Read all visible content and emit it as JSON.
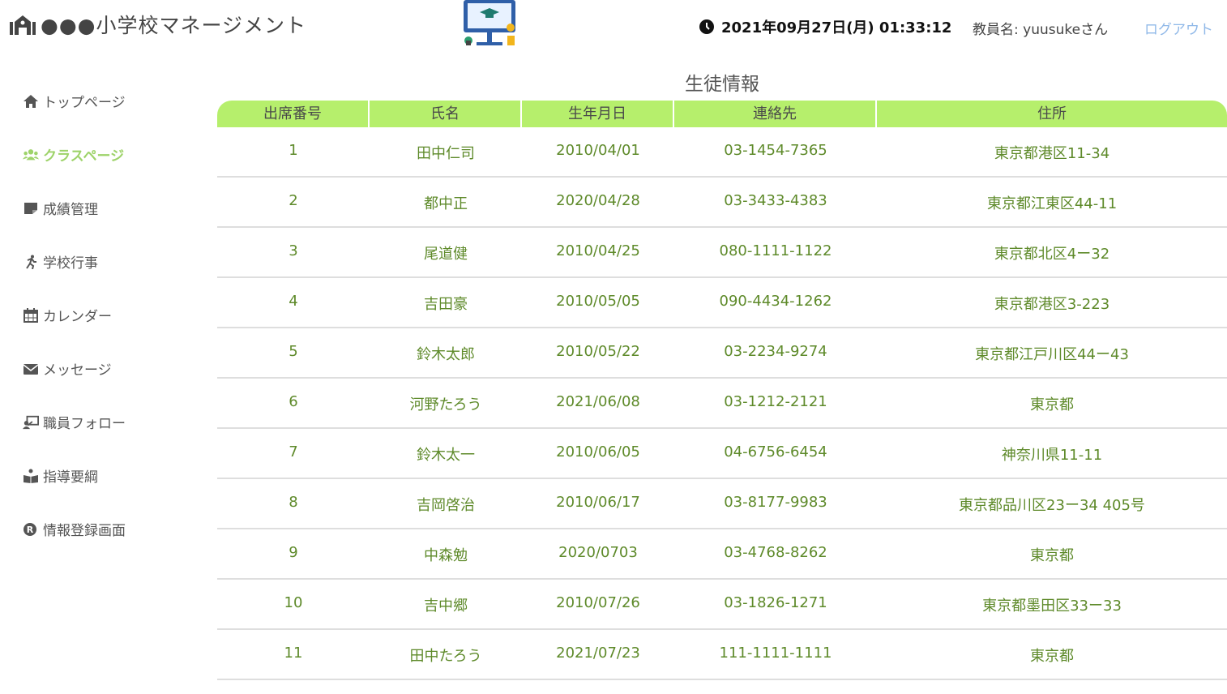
{
  "header": {
    "app_title": "●●●小学校マネージメント",
    "datetime": "2021年09月27日(月) 01:33:12",
    "teacher_label": "教員名: yuusukeさん",
    "logout_label": "ログアウト"
  },
  "sidebar": {
    "items": [
      {
        "label": "トップページ",
        "icon": "home-icon"
      },
      {
        "label": "クラスページ",
        "icon": "users-icon",
        "active": true
      },
      {
        "label": "成績管理",
        "icon": "note-icon"
      },
      {
        "label": "学校行事",
        "icon": "running-icon"
      },
      {
        "label": "カレンダー",
        "icon": "calendar-icon"
      },
      {
        "label": "メッセージ",
        "icon": "envelope-icon"
      },
      {
        "label": "職員フォロー",
        "icon": "teacher-icon"
      },
      {
        "label": "指導要綱",
        "icon": "reader-icon"
      },
      {
        "label": "情報登録画面",
        "icon": "registered-icon"
      }
    ]
  },
  "main": {
    "title": "生徒情報",
    "columns": [
      "出席番号",
      "氏名",
      "生年月日",
      "連絡先",
      "住所"
    ],
    "rows": [
      [
        "1",
        "田中仁司",
        "2010/04/01",
        "03-1454-7365",
        "東京都港区11-34"
      ],
      [
        "2",
        "都中正",
        "2020/04/28",
        "03-3433-4383",
        "東京都江東区44-11"
      ],
      [
        "3",
        "尾道健",
        "2010/04/25",
        "080-1111-1122",
        "東京都北区4ー32"
      ],
      [
        "4",
        "吉田豪",
        "2010/05/05",
        "090-4434-1262",
        "東京都港区3-223"
      ],
      [
        "5",
        "鈴木太郎",
        "2010/05/22",
        "03-2234-9274",
        "東京都江戸川区44ー43"
      ],
      [
        "6",
        "河野たろう",
        "2021/06/08",
        "03-1212-2121",
        "東京都"
      ],
      [
        "7",
        "鈴木太一",
        "2010/06/05",
        "04-6756-6454",
        "神奈川県11-11"
      ],
      [
        "8",
        "吉岡啓治",
        "2010/06/17",
        "03-8177-9983",
        "東京都品川区23ー34 405号"
      ],
      [
        "9",
        "中森勉",
        "2020/0703",
        "03-4768-8262",
        "東京都"
      ],
      [
        "10",
        "吉中郷",
        "2010/07/26",
        "03-1826-1271",
        "東京都墨田区33ー33"
      ],
      [
        "11",
        "田中たろう",
        "2021/07/23",
        "111-1111-1111",
        "東京都"
      ]
    ]
  },
  "colors": {
    "accent": "#9ed36a",
    "header_bg": "#b6ef6c",
    "cell_text": "#5e8a2a",
    "logout": "#8fb8e8"
  }
}
